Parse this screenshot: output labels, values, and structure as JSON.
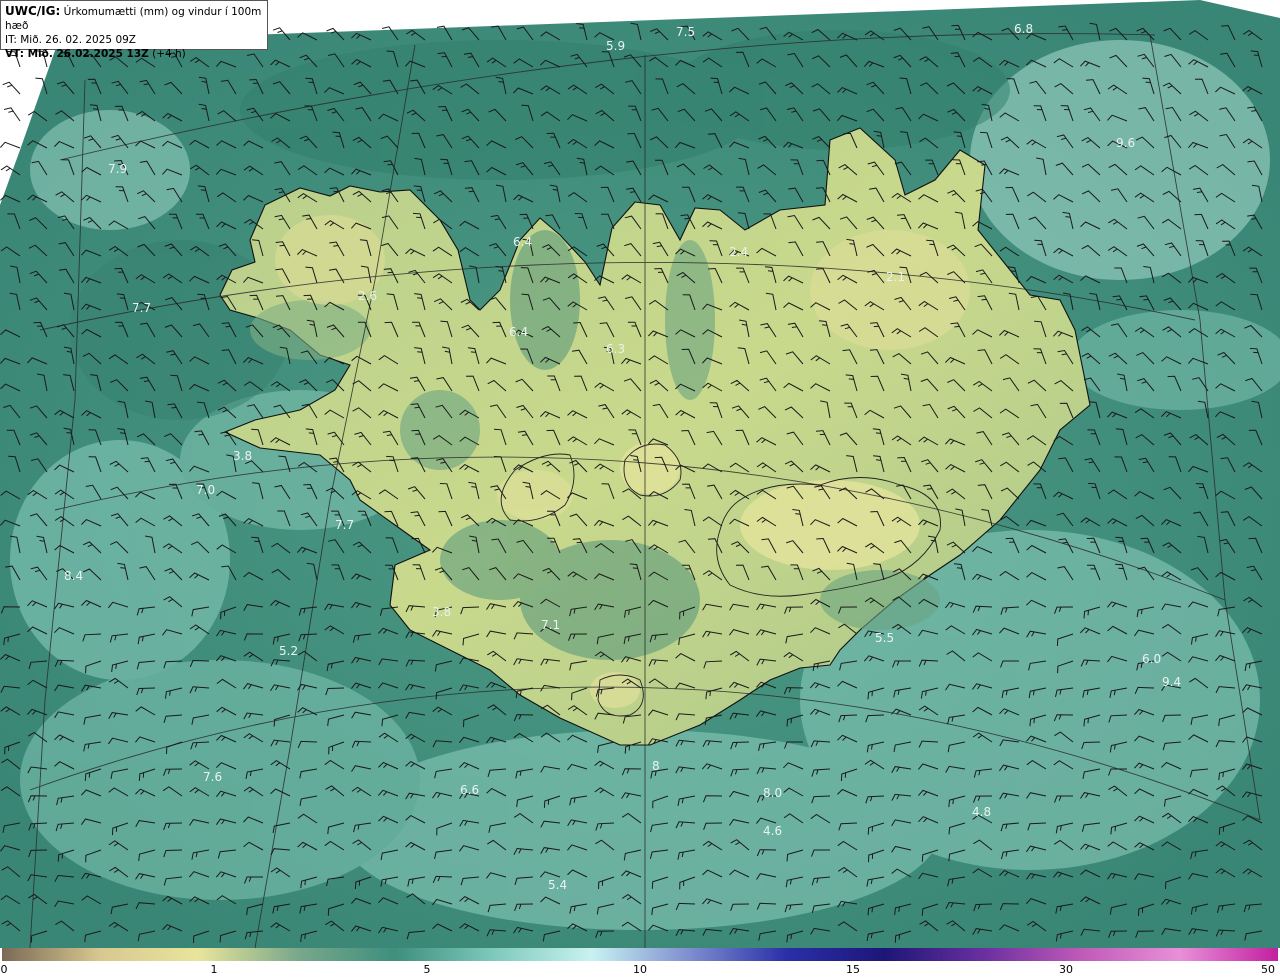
{
  "header": {
    "model_label": "UWC/IG:",
    "title": "Úrkomumætti (mm) og vindur í 100m hæð",
    "it_line": "IT: Mið. 26. 02. 2025 09Z",
    "vt_label": "VT: Mið. 26.02.2025 13Z",
    "vt_offset": " (+4 h)"
  },
  "colors": {
    "sea_base": "#3e8f7e",
    "land_base": "#5e9d7c",
    "land_highlight": "#c9d98c",
    "light_patch": "#a9dccf",
    "coastline": "#111111",
    "grid_line": "#2a2a2a",
    "barb": "#1a1a1a"
  },
  "colorbar": {
    "tick_labels": [
      "0",
      "1",
      "5",
      "10",
      "15",
      "30",
      "50"
    ],
    "stops": [
      "#7a6a55",
      "#d8c890",
      "#e8e59a",
      "#7aa88a",
      "#3e8f7e",
      "#7ec9bc",
      "#c8f2f0",
      "#7f8fd0",
      "#2a2fa8",
      "#1d1678",
      "#6a2fa0",
      "#c05ab8",
      "#e890d8",
      "#c21fa0"
    ]
  },
  "map_labels": [
    {
      "text": "5.9"
    },
    {
      "text": "7.5"
    },
    {
      "text": "6.8"
    },
    {
      "text": "9.6"
    },
    {
      "text": "7.9"
    },
    {
      "text": "6.4"
    },
    {
      "text": "2.4"
    },
    {
      "text": "2.1"
    },
    {
      "text": "7.7"
    },
    {
      "text": "2.6"
    },
    {
      "text": "6.4"
    },
    {
      "text": "6.3"
    },
    {
      "text": "3.8"
    },
    {
      "text": "7.0"
    },
    {
      "text": "7.7"
    },
    {
      "text": "8.4"
    },
    {
      "text": "3.8"
    },
    {
      "text": "7.1"
    },
    {
      "text": "5.2"
    },
    {
      "text": "6.0"
    },
    {
      "text": "9.4"
    },
    {
      "text": "4.8"
    },
    {
      "text": "4.6"
    },
    {
      "text": "5.4"
    },
    {
      "text": "7.6"
    },
    {
      "text": "6.6"
    },
    {
      "text": "8"
    },
    {
      "text": "8.0"
    },
    {
      "text": "5.5"
    }
  ]
}
